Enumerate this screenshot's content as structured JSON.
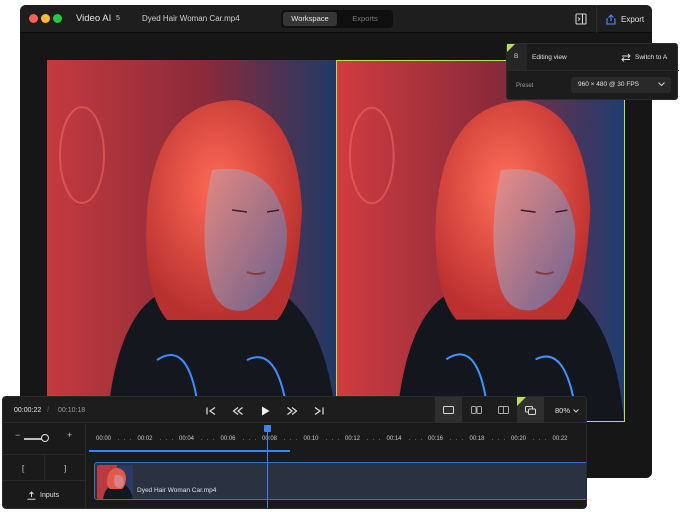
{
  "titlebar": {
    "app_title": "Video AI",
    "count_badge": "5",
    "file_name": "Dyed Hair Woman Car.mp4",
    "tabs": [
      "Workspace",
      "Exports"
    ],
    "active_tab": "Workspace",
    "export_label": "Export"
  },
  "popover": {
    "badge": "B",
    "title": "Editing view",
    "switch_label": "Switch to A",
    "preset_label": "Preset",
    "preset_value": "960 × 480 @ 30 FPS"
  },
  "transport": {
    "current_time": "00:00:22",
    "total_time": "00:10:18",
    "zoom_value": "80%"
  },
  "ruler": {
    "labels": [
      "00:00",
      "00:02",
      "00:04",
      "00:06",
      "00:08",
      "00:10",
      "00:12",
      "00:14",
      "00:16",
      "00:18",
      "00:20",
      "00:22"
    ]
  },
  "sidebar": {
    "in_bracket": "[",
    "out_bracket": "]",
    "inputs_label": "Inputs"
  },
  "clip": {
    "name": "Dyed Hair Woman Car.mp4"
  },
  "colors": {
    "accent_green": "#b6e05a",
    "accent_blue": "#3b82f6",
    "window_bg": "#161616"
  }
}
